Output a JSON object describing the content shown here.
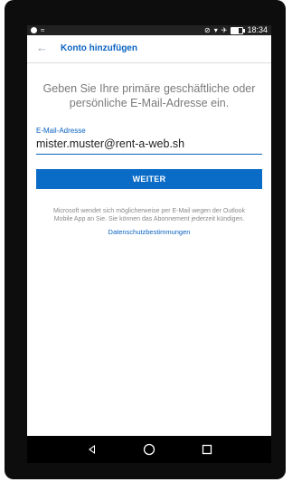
{
  "statusbar": {
    "time": "18:34",
    "battery_level": 0.65
  },
  "appbar": {
    "title": "Konto hinzufügen"
  },
  "main": {
    "instruction": "Geben Sie Ihre primäre geschäftliche oder persönliche E-Mail-Adresse ein.",
    "email_label": "E-Mail-Adresse",
    "email_value": "mister.muster@rent-a-web.sh",
    "continue_label": "WEITER",
    "disclaimer": "Microsoft wendet sich möglicherweise per E-Mail wegen der Outlook Mobile App an Sie. Sie können das Abonnement jederzeit kündigen.",
    "privacy_link": "Datenschutzbestimmungen"
  },
  "icons": {
    "back": "arrow-left-icon",
    "nav_back": "triangle-back-icon",
    "nav_home": "circle-home-icon",
    "nav_recents": "square-recents-icon"
  },
  "colors": {
    "accent": "#0a63c2",
    "button": "#0a6cc7"
  }
}
